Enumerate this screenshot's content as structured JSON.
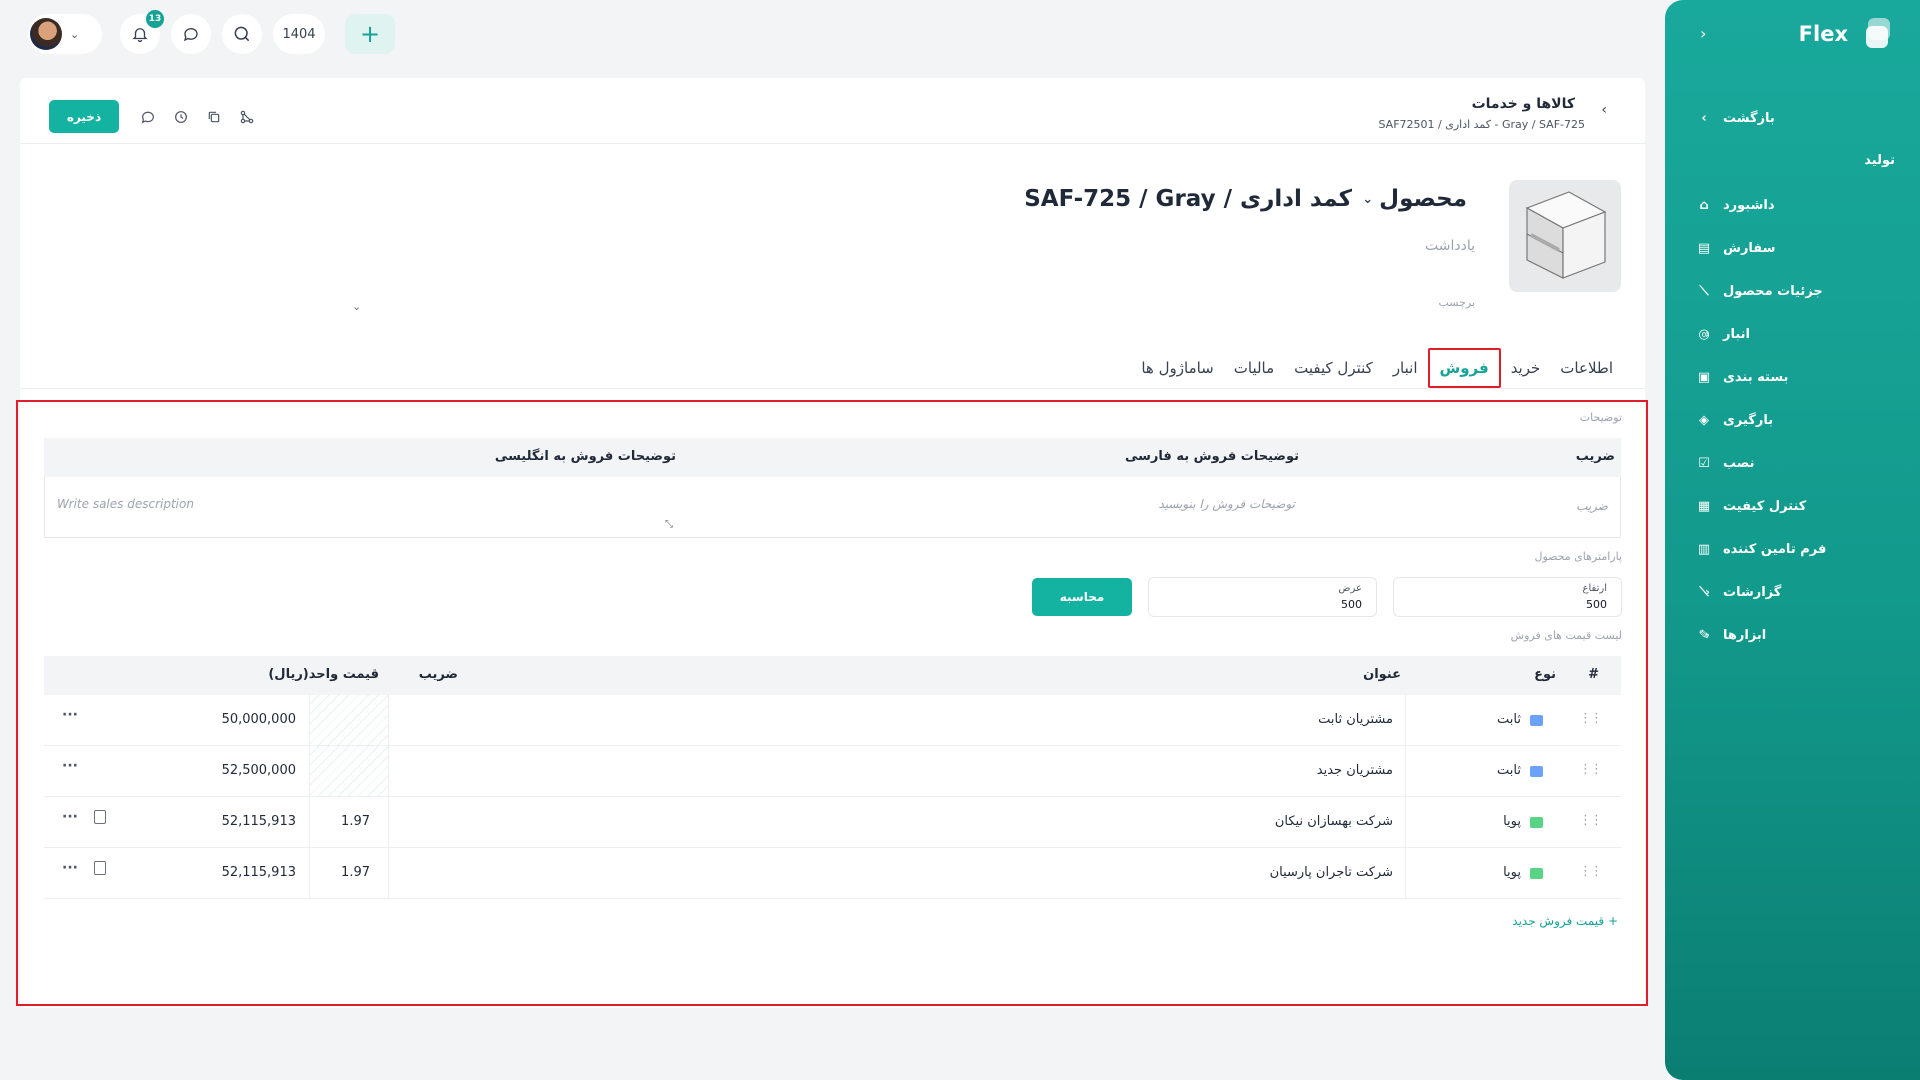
{
  "topbar": {
    "year": "1404",
    "notification_count": "13"
  },
  "sidebar": {
    "brand": "Flex",
    "back_label": "بازگشت",
    "section": "تولید",
    "items": [
      {
        "label": "داشبورد",
        "icon": "home-icon",
        "has_children": false
      },
      {
        "label": "سفارش",
        "icon": "order-icon",
        "has_children": false
      },
      {
        "label": "جزئیات محصول",
        "icon": "chart-icon",
        "has_children": false
      },
      {
        "label": "انبار",
        "icon": "warehouse-icon",
        "has_children": true
      },
      {
        "label": "بسته بندی",
        "icon": "package-icon",
        "has_children": false
      },
      {
        "label": "بارگیری",
        "icon": "box-icon",
        "has_children": false
      },
      {
        "label": "نصب",
        "icon": "check-icon",
        "has_children": false
      },
      {
        "label": "کنترل کیفیت",
        "icon": "grid-icon",
        "has_children": false
      },
      {
        "label": "فرم تامین کننده",
        "icon": "form-icon",
        "has_children": false
      },
      {
        "label": "گزارشات",
        "icon": "report-icon",
        "has_children": true
      },
      {
        "label": "ابزارها",
        "icon": "tools-icon",
        "has_children": true
      }
    ]
  },
  "header": {
    "title": "کالاها و خدمات",
    "subtitle": "Gray / SAF-725 - کمد اداری / SAF72501",
    "save_label": "ذخیره"
  },
  "product": {
    "kind": "محصول",
    "name": "کمد اداری / SAF-725 / Gray",
    "note_placeholder": "یادداشت",
    "tag_placeholder": "برچسب"
  },
  "tabs": [
    {
      "label": "اطلاعات",
      "active": false
    },
    {
      "label": "خرید",
      "active": false
    },
    {
      "label": "فروش",
      "active": true
    },
    {
      "label": "انبار",
      "active": false
    },
    {
      "label": "کنترل کیفیت",
      "active": false
    },
    {
      "label": "مالیات",
      "active": false
    },
    {
      "label": "ساماژول ها",
      "active": false
    }
  ],
  "description": {
    "section_label": "توضیحات",
    "col_factor": "ضریب",
    "col_fa": "توضیحات فروش به فارسی",
    "col_en": "توضیحات فروش به انگلیسی",
    "factor_placeholder": "ضریب",
    "fa_placeholder": "توضیحات فروش را بنویسید",
    "en_placeholder": "Write sales description"
  },
  "params": {
    "section_label": "پارامترهای محصول",
    "height_label": "ارتفاع",
    "height_value": "500",
    "width_label": "عرض",
    "width_value": "500",
    "calc_label": "محاسبه"
  },
  "price_list": {
    "section_label": "لیست قیمت های فروش",
    "columns": {
      "index": "#",
      "type": "نوع",
      "title": "عنوان",
      "factor": "ضریب",
      "unit_price": "قیمت واحد(ریال)"
    },
    "rows": [
      {
        "type": "ثابت",
        "type_color": "#3b82f6",
        "title": "مشتریان ثابت",
        "factor": "",
        "unit_price": "50,000,000",
        "has_doc": false
      },
      {
        "type": "ثابت",
        "type_color": "#3b82f6",
        "title": "مشتریان جدید",
        "factor": "",
        "unit_price": "52,500,000",
        "has_doc": false
      },
      {
        "type": "پویا",
        "type_color": "#22c55e",
        "title": "شرکت بهسازان نیکان",
        "factor": "1.97",
        "unit_price": "52,115,913",
        "has_doc": true
      },
      {
        "type": "پویا",
        "type_color": "#22c55e",
        "title": "شرکت تاجران پارسیان",
        "factor": "1.97",
        "unit_price": "52,115,913",
        "has_doc": true
      }
    ],
    "add_label": "+ قیمت فروش جدید"
  }
}
